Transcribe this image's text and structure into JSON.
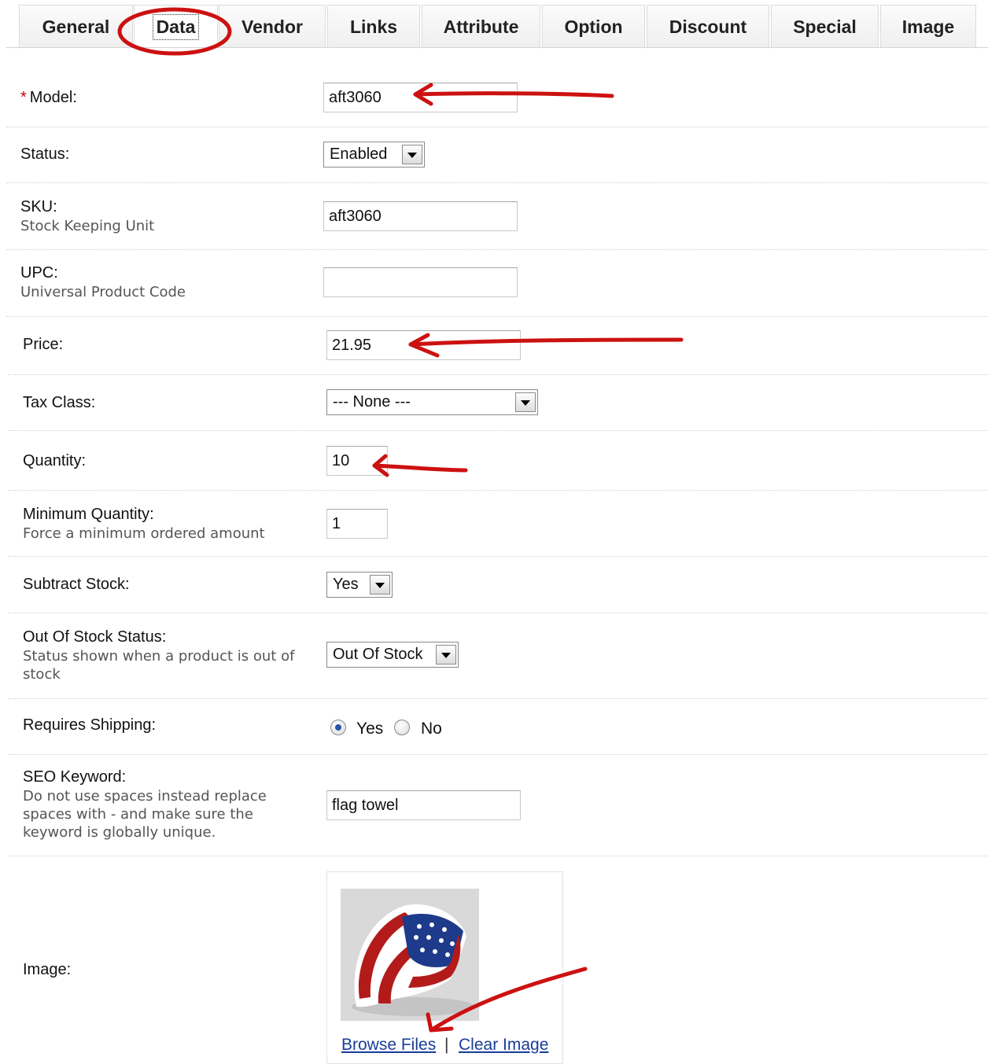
{
  "tabs": [
    "General",
    "Data",
    "Vendor",
    "Links",
    "Attribute",
    "Option",
    "Discount",
    "Special",
    "Image"
  ],
  "active_tab": "Data",
  "form": {
    "model": {
      "label": "Model:",
      "required_mark": "*",
      "value": "aft3060"
    },
    "status": {
      "label": "Status:",
      "selected": "Enabled"
    },
    "sku": {
      "label": "SKU:",
      "help": "Stock Keeping Unit",
      "value": "aft3060"
    },
    "upc": {
      "label": "UPC:",
      "help": "Universal Product Code",
      "value": ""
    },
    "price": {
      "label": "Price:",
      "value": "21.95"
    },
    "tax_class": {
      "label": "Tax Class:",
      "selected": "--- None ---"
    },
    "quantity": {
      "label": "Quantity:",
      "value": "10"
    },
    "minimum": {
      "label": "Minimum Quantity:",
      "help": "Force a minimum ordered amount",
      "value": "1"
    },
    "subtract": {
      "label": "Subtract Stock:",
      "selected": "Yes"
    },
    "stock_status": {
      "label": "Out Of Stock Status:",
      "help": "Status shown when a product is out of stock",
      "selected": "Out Of Stock"
    },
    "shipping": {
      "label": "Requires Shipping:",
      "yes": "Yes",
      "no": "No",
      "selected": "Yes"
    },
    "seo": {
      "label": "SEO Keyword:",
      "help": "Do not use spaces instead replace spaces with - and make sure the keyword is globally unique.",
      "value": "flag towel"
    },
    "image": {
      "label": "Image:",
      "browse": "Browse Files",
      "separator": "|",
      "clear": "Clear Image"
    }
  },
  "colors": {
    "annotation": "#cc1111",
    "link": "#1a3d9a",
    "required": "#cc0000"
  }
}
